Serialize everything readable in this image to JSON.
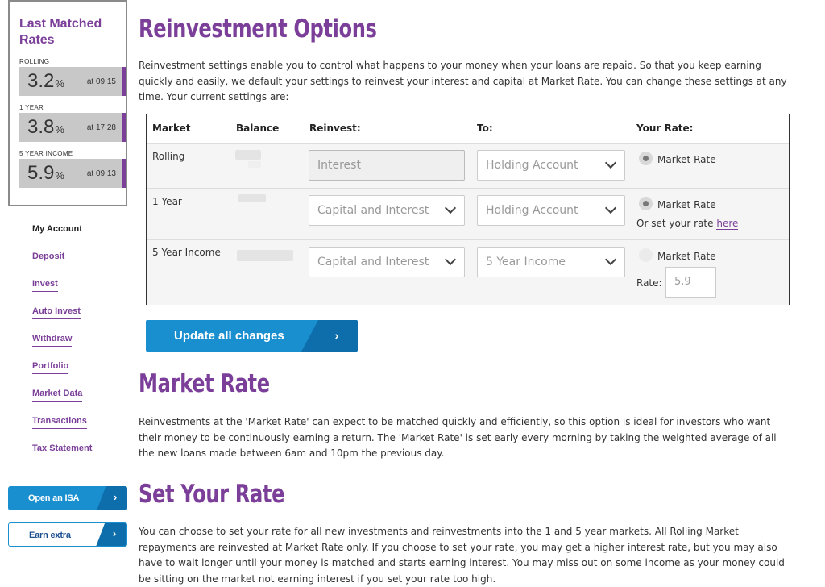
{
  "rates": {
    "title": "Last Matched Rates",
    "items": [
      {
        "label": "ROLLING",
        "value": "3.2",
        "unit": "%",
        "time": "at 09:15"
      },
      {
        "label": "1 YEAR",
        "value": "3.8",
        "unit": "%",
        "time": "at 17:28"
      },
      {
        "label": "5 YEAR INCOME",
        "value": "5.9",
        "unit": "%",
        "time": "at 09:13"
      }
    ]
  },
  "menu": {
    "heading": "My Account",
    "items": [
      "Deposit",
      "Invest",
      "Auto Invest",
      "Withdraw",
      "Portfolio",
      "Market Data",
      "Transactions",
      "Tax Statement"
    ]
  },
  "side_buttons": {
    "isa": "Open an ISA",
    "extra": "Earn extra",
    "arrow": "›"
  },
  "reinvest": {
    "title": "Reinvestment Options",
    "intro": "Reinvestment settings enable you to control what happens to your money when your loans are repaid. So that you keep earning quickly and easily, we default your settings to reinvest your interest and capital at Market Rate. You can change these settings at any time. Your current settings are:"
  },
  "table": {
    "headers": {
      "market": "Market",
      "balance": "Balance",
      "reinvest": "Reinvest:",
      "to": "To:",
      "rate": "Your Rate:"
    },
    "rows": [
      {
        "market": "Rolling",
        "reinvest": "Interest",
        "to": "Holding Account",
        "rate_label": "Market Rate"
      },
      {
        "market": "1 Year",
        "reinvest": "Capital and Interest",
        "to": "Holding Account",
        "rate_label": "Market Rate",
        "set_rate_text": "Or set your rate",
        "set_rate_link": "here"
      },
      {
        "market": "5 Year Income",
        "reinvest": "Capital and Interest",
        "to": "5 Year Income",
        "rate_label": "Market Rate",
        "rate_field_label": "Rate:",
        "rate_value": "5.9"
      }
    ]
  },
  "update_button": {
    "label": "Update all changes",
    "arrow": "›"
  },
  "market_rate": {
    "title": "Market Rate",
    "text": "Reinvestments at the 'Market Rate' can expect to be matched quickly and efficiently, so this option is ideal for investors who want their money to be continuously earning a return. The 'Market Rate' is set early every morning by taking the weighted average of all the new loans made between 6am and 10pm the previous day."
  },
  "set_rate": {
    "title": "Set Your Rate",
    "text": "You can choose to set your rate for all new investments and reinvestments into the 1 and 5 year markets. All Rolling Market repayments are reinvested at Market Rate only. If you choose to set your rate, you may get a higher interest rate, but you may also have to wait longer until your money is matched and starts earning interest. You may miss out on some income as your money could be sitting on the market not earning interest if you set your rate too high."
  },
  "colors": {
    "brand_purple": "#7b3f99",
    "button_blue": "#1a8fcf",
    "button_dark_blue": "#0d6eab"
  }
}
